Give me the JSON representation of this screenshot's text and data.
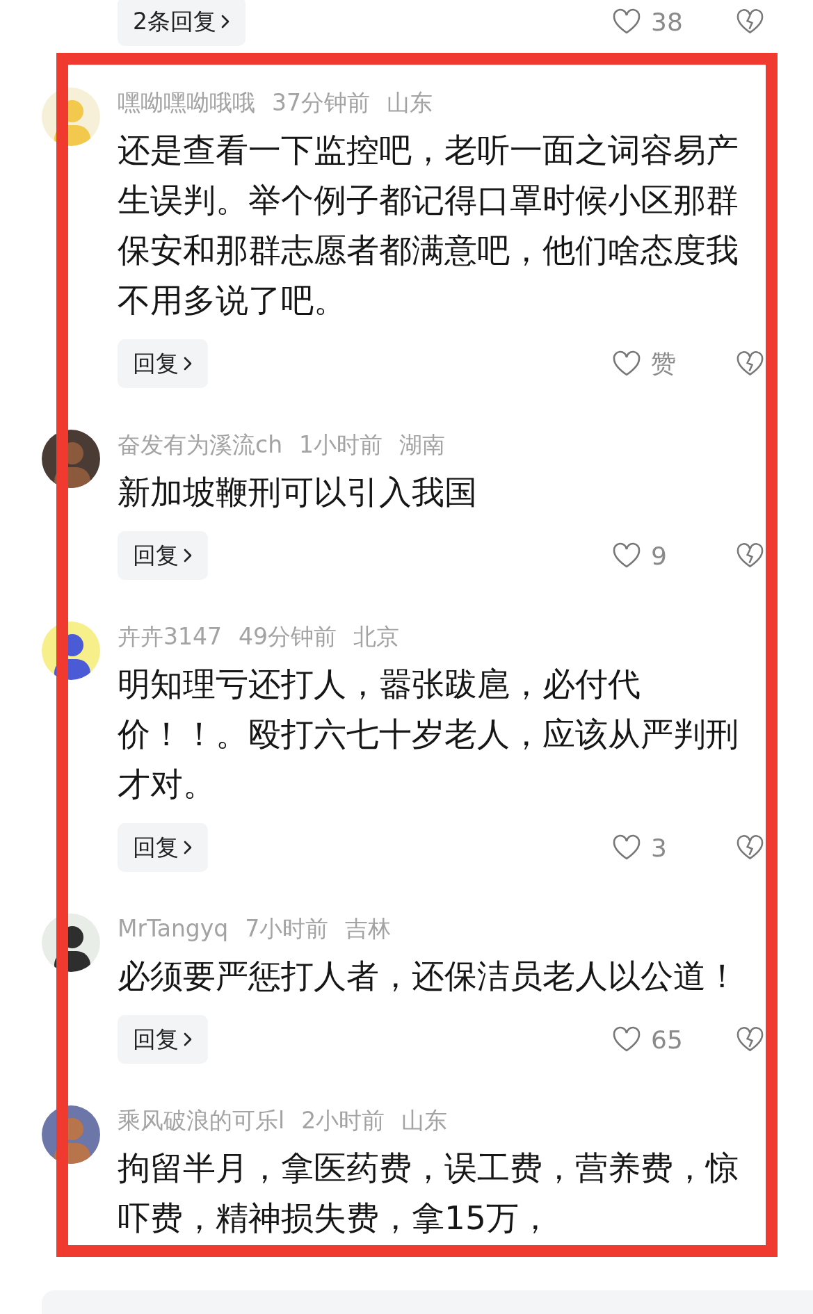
{
  "top_partial": {
    "reply_button": "2条回复",
    "like_count": "38"
  },
  "comments": [
    {
      "username": "嘿呦嘿呦哦哦",
      "time": "37分钟前",
      "location": "山东",
      "lines": [
        "还是查看一下监控吧，老听一面之词容易产",
        "生误判。举个例子都记得口罩时候小区那群",
        "保安和那群志愿者都满意吧，他们啥态度我",
        "不用多说了吧。"
      ],
      "reply_button": "回复",
      "like_count": "赞"
    },
    {
      "username": "奋发有为溪流ch",
      "time": "1小时前",
      "location": "湖南",
      "lines": [
        "新加坡鞭刑可以引入我国"
      ],
      "reply_button": "回复",
      "like_count": "9"
    },
    {
      "username": "卉卉3147",
      "time": "49分钟前",
      "location": "北京",
      "lines": [
        "明知理亏还打人，嚣张跋扈，必付代",
        "价！！。殴打六七十岁老人，应该从严判刑",
        "才对。"
      ],
      "reply_button": "回复",
      "like_count": "3"
    },
    {
      "username": "MrTangyq",
      "time": "7小时前",
      "location": "吉林",
      "lines": [
        "必须要严惩打人者，还保洁员老人以公道！"
      ],
      "reply_button": "回复",
      "like_count": "65"
    },
    {
      "username": "乘风破浪的可乐l",
      "time": "2小时前",
      "location": "山东",
      "lines": [
        "拘留半月，拿医药费，误工费，营养费，惊",
        "吓费，精神损失费，拿15万，"
      ]
    }
  ]
}
